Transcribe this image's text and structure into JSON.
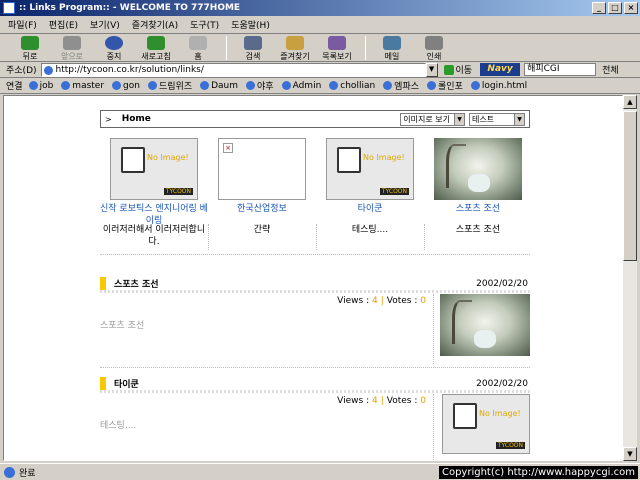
{
  "window": {
    "title": ":: Links Program:: - WELCOME TO 777HOME",
    "min_glyph": "_",
    "max_glyph": "□",
    "close_glyph": "×"
  },
  "menu": [
    "파일(F)",
    "편집(E)",
    "보기(V)",
    "즐겨찾기(A)",
    "도구(T)",
    "도움말(H)"
  ],
  "toolbar": {
    "back": "뒤로",
    "forward": "앞으로",
    "stop": "중지",
    "refresh": "새로고침",
    "home": "홈",
    "search": "검색",
    "favorites": "즐겨찾기",
    "history": "목록보기",
    "mail": "메일",
    "print": "인쇄",
    "colors": {
      "back": "#2f8f2f",
      "forward": "#8f8f8f",
      "stop": "#3355aa",
      "refresh": "#2f8f2f",
      "home": "#b0b0b0",
      "search": "#5a6a8a",
      "favorites": "#c8a040",
      "history": "#7a5aa0",
      "mail": "#4a7aa0",
      "print": "#808080"
    }
  },
  "address": {
    "label": "주소(D)",
    "url": "http://tycoon.co.kr/solution/links/",
    "go_label": "이동",
    "navy_logo": "Navy",
    "search_value": "해피CGI",
    "extra_label": "전체"
  },
  "links": {
    "label": "연결",
    "items": [
      "job",
      "master",
      "gon",
      "드림위즈",
      "Daum",
      "야후",
      "Admin",
      "chollian",
      "엠파스",
      "롤인포",
      "login.html"
    ]
  },
  "page": {
    "home_label": "Home",
    "view_select": "이미지로 보기",
    "theme_select": "테스트",
    "no_image_text": "No Image!",
    "tycoon_logo": "TYCOON",
    "broken_glyph": "×",
    "grid": [
      {
        "caption": "신작 로보틱스 엔지니어링 베이링",
        "desc": "이러저러해서 이러저러합니다.",
        "thumb": "noimage"
      },
      {
        "caption": "한국산업정보",
        "desc": "간략",
        "thumb": "broken"
      },
      {
        "caption": "타이쿤",
        "desc": "테스팅....",
        "thumb": "noimage"
      },
      {
        "caption": "스포츠 조선",
        "desc": "스포츠 조선",
        "thumb": "painting"
      }
    ],
    "entries": [
      {
        "title": "스포츠 조선",
        "date": "2002/02/20",
        "views_label": "Views :",
        "views": "4",
        "votes_label": "Votes :",
        "votes": "0",
        "desc": "스포츠 조선",
        "thumb": "painting"
      },
      {
        "title": "타이쿤",
        "date": "2002/02/20",
        "views_label": "Views :",
        "views": "4",
        "votes_label": "Votes :",
        "votes": "0",
        "desc": "테스팅....",
        "thumb": "noimage"
      }
    ]
  },
  "status": {
    "text": "완료",
    "copyright": "Copyright(c) http://www.happycgi.com"
  },
  "colors": {
    "link": "#1a56b8",
    "accent": "#f8c800",
    "count": "#e8a000"
  }
}
